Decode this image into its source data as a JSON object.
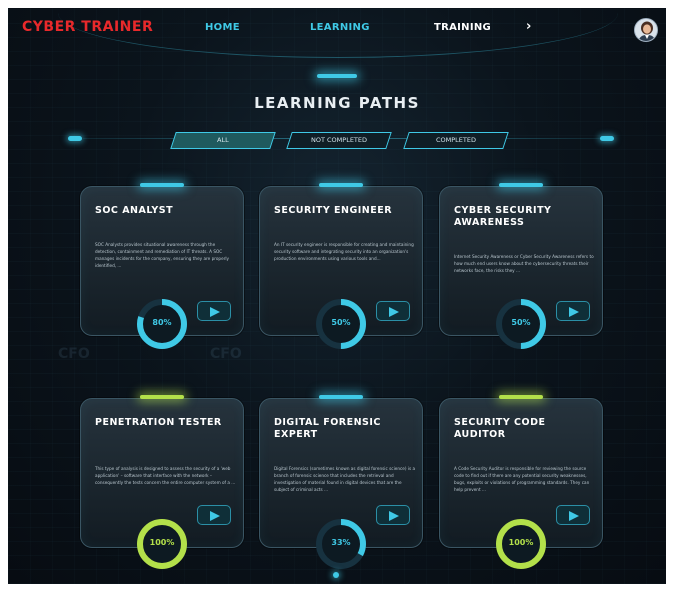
{
  "nav": {
    "logo": "CYBER TRAINER",
    "links": [
      "HOME",
      "LEARNING",
      "TRAINING"
    ],
    "more": "›"
  },
  "page_title": "LEARNING PATHS",
  "filters": [
    "ALL",
    "NOT COMPLETED",
    "COMPLETED"
  ],
  "active_filter": "ALL",
  "colors": {
    "accent": "#3fc9e6",
    "complete": "#b3e04a",
    "logo": "#e8292b"
  },
  "cards": [
    {
      "title": "SOC ANALYST",
      "description": "SOC Analysts provides situational awareness through the detection, containment and remediation of IT threats. A SOC manages incidents for the company, ensuring they are properly identified, ...",
      "progress_label": "80%",
      "progress": 80,
      "status": "in-progress"
    },
    {
      "title": "SECURITY ENGINEER",
      "description": "An IT security engineer is responsible for creating and maintaining security software and integrating security into an organization's production environments using various tools and...",
      "progress_label": "50%",
      "progress": 50,
      "status": "in-progress"
    },
    {
      "title": "CYBER SECURITY AWARENESS",
      "description": "Internet Security Awareness or Cyber Security Awareness refers to how much end users know about the cybersecurity threats their networks face, the risks they ...",
      "progress_label": "50%",
      "progress": 50,
      "status": "in-progress"
    },
    {
      "title": "PENETRATION TESTER",
      "description": "This type of analysis is designed to assess the security of a 'web application' – software that interface with the network – consequently the tests concern the entire computer system of a ...",
      "progress_label": "100%",
      "progress": 100,
      "status": "completed"
    },
    {
      "title": "DIGITAL FORENSIC EXPERT",
      "description": "Digital Forensics (sometimes known as digital forensic science) is a branch of forensic science that includes the retrieval and investigation of material found in digital devices that are the subject of criminal acts ...",
      "progress_label": "33%",
      "progress": 33,
      "status": "in-progress"
    },
    {
      "title": "SECURITY CODE AUDITOR",
      "description": "A Code Security Auditor is responsible for reviewing the source code to find out if there are any potential security weaknesses, bugs, exploits or violations of programming standards. They can help prevent ...",
      "progress_label": "100%",
      "progress": 100,
      "status": "completed"
    }
  ],
  "background_marks": [
    "CFO",
    "CFO"
  ]
}
